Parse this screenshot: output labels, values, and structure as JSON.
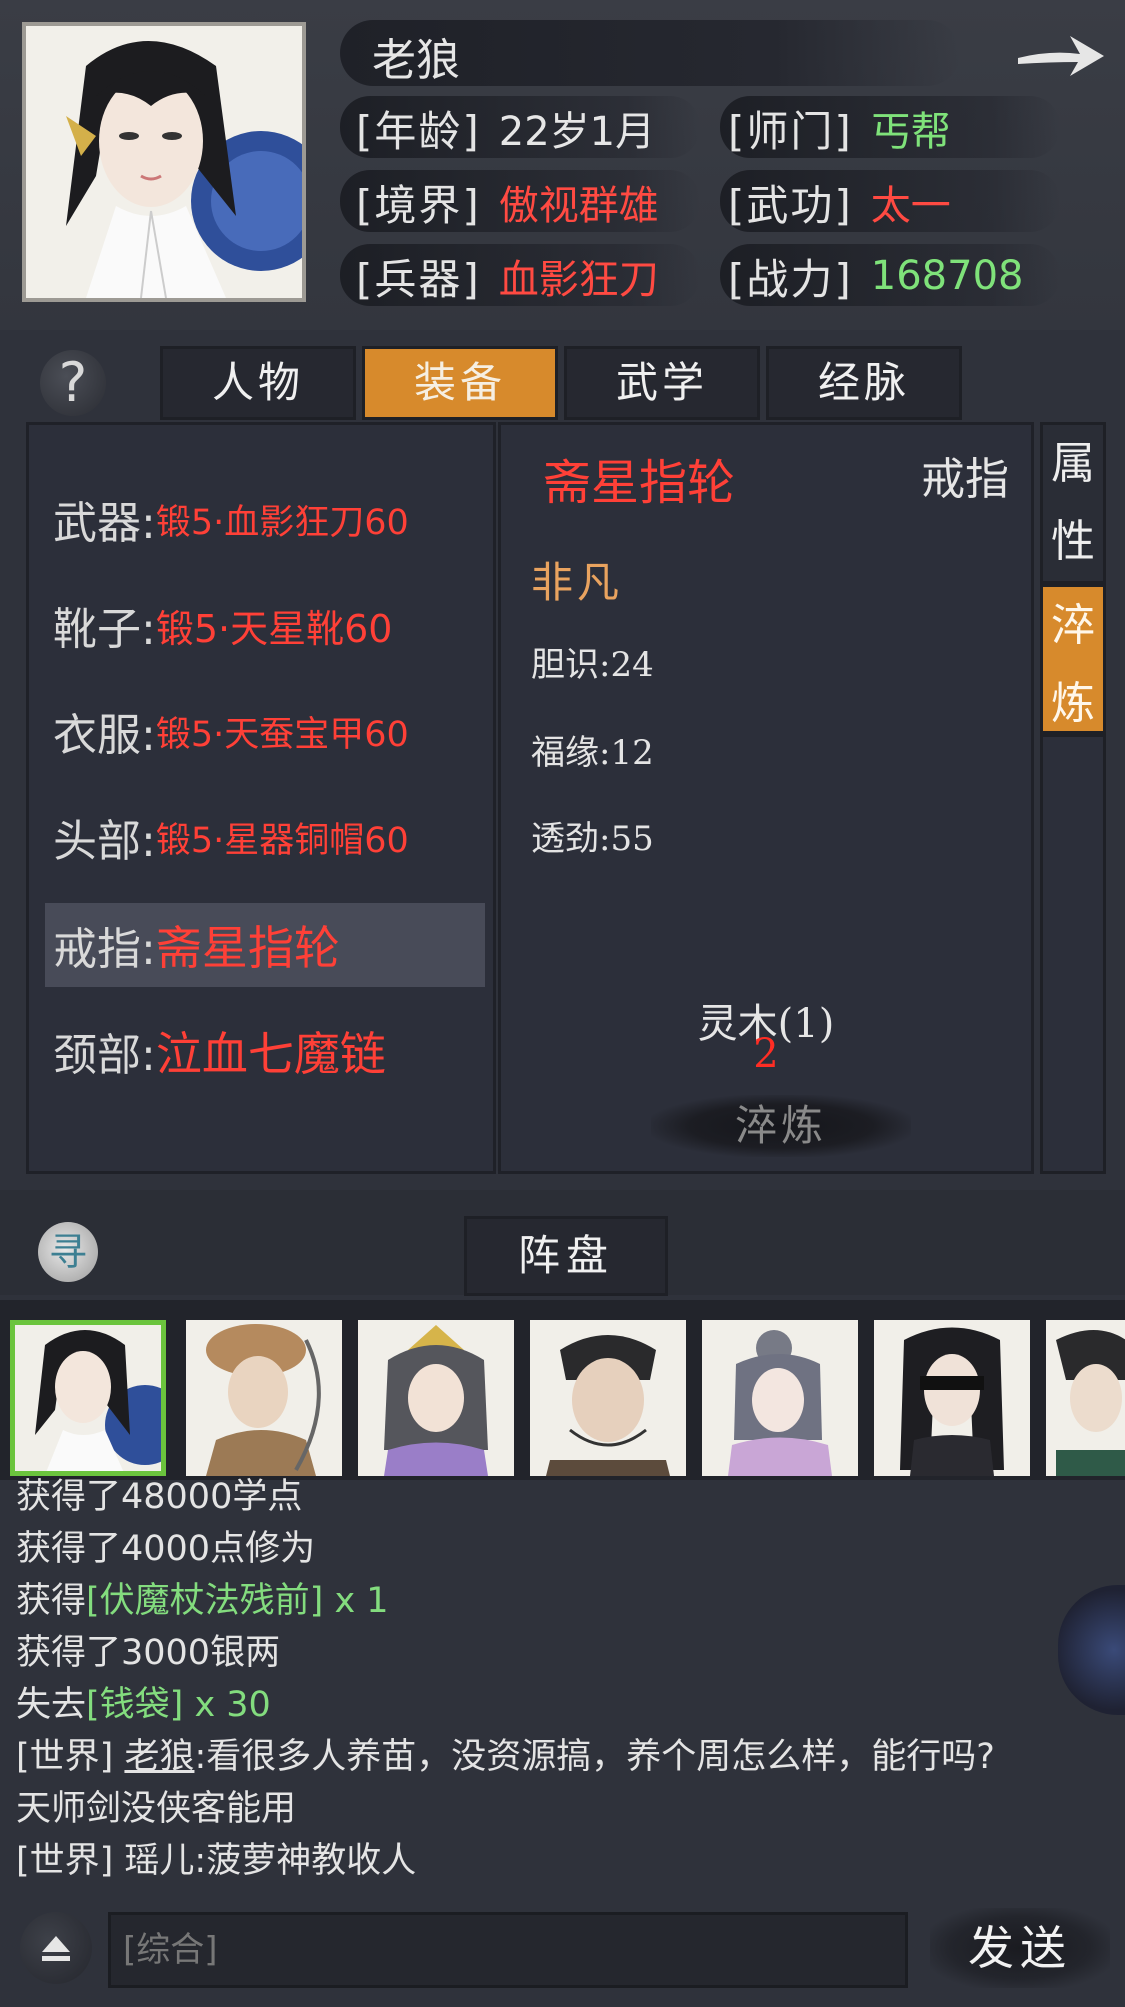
{
  "header": {
    "name": "老狼",
    "info": [
      {
        "label": "[年龄]",
        "value": "22岁1月",
        "color": "#e6e6e6"
      },
      {
        "label": "[师门]",
        "value": "丐帮",
        "color": "#7fe27a"
      },
      {
        "label": "[境界]",
        "value": "傲视群雄",
        "color": "#ff4a42"
      },
      {
        "label": "[武功]",
        "value": "太一",
        "color": "#ff4a42"
      },
      {
        "label": "[兵器]",
        "value": "血影狂刀",
        "color": "#ff4a42"
      },
      {
        "label": "[战力]",
        "value": "168708",
        "color": "#7fe27a"
      }
    ]
  },
  "tabs": [
    {
      "label": "人物",
      "active": false
    },
    {
      "label": "装备",
      "active": true
    },
    {
      "label": "武学",
      "active": false
    },
    {
      "label": "经脉",
      "active": false
    }
  ],
  "help_icon": "?",
  "equipment_slots": [
    {
      "label": "武器:",
      "value": "锻5·血影狂刀60"
    },
    {
      "label": "靴子:",
      "value": "锻5·天星靴60"
    },
    {
      "label": "衣服:",
      "value": "锻5·天蚕宝甲60"
    },
    {
      "label": "头部:",
      "value": "锻5·星器铜帽60"
    },
    {
      "label": "戒指:",
      "value": "斋星指轮",
      "selected": true
    },
    {
      "label": "颈部:",
      "value": "泣血七魔链"
    }
  ],
  "item_detail": {
    "name": "斋星指轮",
    "type": "戒指",
    "rarity": "非凡",
    "stats": [
      "胆识:24",
      "福缘:12",
      "透劲:55"
    ],
    "material": "灵木(1)",
    "material_count": "2",
    "refine_button": "淬炼"
  },
  "side_tabs": [
    {
      "label": [
        "属",
        "性"
      ],
      "active": false
    },
    {
      "label": [
        "淬",
        "炼"
      ],
      "active": true
    }
  ],
  "formation": {
    "seek_icon": "寻",
    "tab_label": "阵盘"
  },
  "chat": {
    "lines": [
      {
        "parts": [
          {
            "t": "获得了48000学点"
          }
        ]
      },
      {
        "parts": [
          {
            "t": "获得了4000点修为"
          }
        ]
      },
      {
        "parts": [
          {
            "t": "获得"
          },
          {
            "t": "[伏魔杖法残前]",
            "green": true
          },
          {
            "t": " x 1"
          }
        ]
      },
      {
        "parts": [
          {
            "t": "获得了3000银两"
          }
        ]
      },
      {
        "parts": [
          {
            "t": "失去"
          },
          {
            "t": "[钱袋]",
            "green": true
          },
          {
            "t": " x 30"
          }
        ]
      },
      {
        "parts": [
          {
            "t": "[世界] "
          },
          {
            "t": "老狼",
            "underline": true
          },
          {
            "t": ":看很多人养苗，没资源搞，养个周怎么样，能行吗?"
          }
        ]
      },
      {
        "parts": [
          {
            "t": "天师剑没侠客能用"
          }
        ]
      },
      {
        "parts": [
          {
            "t": "[世界] 瑶儿:菠萝神教收人"
          }
        ]
      }
    ],
    "input_placeholder": "[综合]",
    "send_label": "发送"
  },
  "colors": {
    "accent_orange": "#d78a2c",
    "equip_red": "#ff4037",
    "green_text": "#7fe27a",
    "rarity_gold": "#e9a35f"
  }
}
